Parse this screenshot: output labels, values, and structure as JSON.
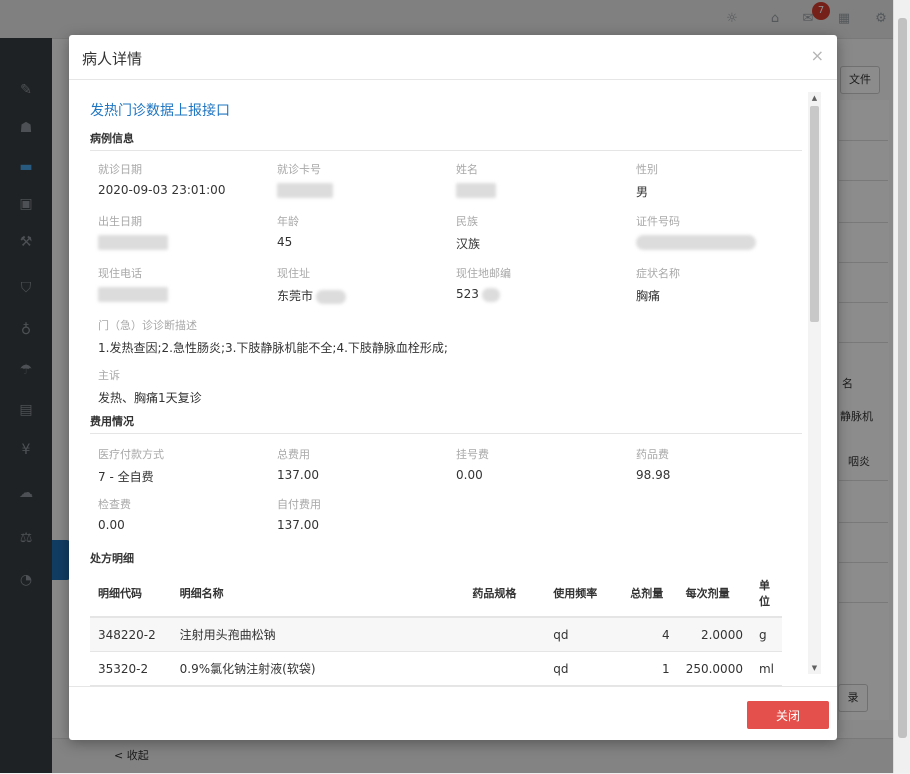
{
  "background": {
    "topbar_badge": "7",
    "right_button_label": "文件",
    "right_texts": [
      "名",
      "静脉机",
      "咽炎"
    ],
    "right_bottom_button": "录",
    "footer_collapse": "< 收起",
    "sidebar_icons": [
      "edit-icon",
      "users-icon",
      "bed-icon",
      "id-card-icon",
      "gavel-icon",
      "shield-icon",
      "stethoscope-icon",
      "umbrella-icon",
      "file-icon",
      "yen-icon",
      "cloud-upload-icon",
      "balance-icon",
      "pie-chart-icon"
    ],
    "accent_color": "#1f76c2"
  },
  "modal": {
    "title": "病人详情",
    "close_symbol": "×",
    "report_title": "发热门诊数据上报接口",
    "sections": {
      "case_info": {
        "title": "病例信息",
        "visit_date": {
          "label": "就诊日期",
          "value": "2020-09-03 23:01:00"
        },
        "card_no": {
          "label": "就诊卡号",
          "value": ""
        },
        "name": {
          "label": "姓名",
          "value": ""
        },
        "gender": {
          "label": "性别",
          "value": "男"
        },
        "birth_date": {
          "label": "出生日期",
          "value": ""
        },
        "age": {
          "label": "年龄",
          "value": "45"
        },
        "ethnicity": {
          "label": "民族",
          "value": "汉族"
        },
        "id_number": {
          "label": "证件号码",
          "value": ""
        },
        "phone": {
          "label": "现住电话",
          "value": ""
        },
        "address": {
          "label": "现住址",
          "value": "东莞市"
        },
        "postcode": {
          "label": "现住地邮编",
          "value": "523"
        },
        "symptom": {
          "label": "症状名称",
          "value": "胸痛"
        },
        "diagnosis": {
          "label": "门（急）诊诊断描述",
          "value": "1.发热查因;2.急性肠炎;3.下肢静脉机能不全;4.下肢静脉血栓形成;"
        },
        "complaint": {
          "label": "主诉",
          "value": "发热、胸痛1天复诊"
        }
      },
      "fees": {
        "title": "费用情况",
        "payment": {
          "label": "医疗付款方式",
          "value": "7 - 全自费"
        },
        "total": {
          "label": "总费用",
          "value": "137.00"
        },
        "registration": {
          "label": "挂号费",
          "value": "0.00"
        },
        "drug": {
          "label": "药品费",
          "value": "98.98"
        },
        "exam": {
          "label": "检查费",
          "value": "0.00"
        },
        "self_pay": {
          "label": "自付费用",
          "value": "137.00"
        }
      },
      "prescription": {
        "title": "处方明细",
        "headers": {
          "code": "明细代码",
          "name": "明细名称",
          "spec": "药品规格",
          "freq": "使用频率",
          "total": "总剂量",
          "dose": "每次剂量",
          "unit": "单位"
        },
        "rows": [
          {
            "code": "348220-2",
            "name": "注射用头孢曲松钠",
            "spec": "",
            "freq": "qd",
            "total": "4",
            "dose": "2.0000",
            "unit": "g"
          },
          {
            "code": "35320-2",
            "name": "0.9%氯化钠注射液(软袋)",
            "spec": "",
            "freq": "qd",
            "total": "1",
            "dose": "250.0000",
            "unit": "ml"
          }
        ]
      }
    },
    "footer": {
      "close_button": "关闭"
    }
  }
}
